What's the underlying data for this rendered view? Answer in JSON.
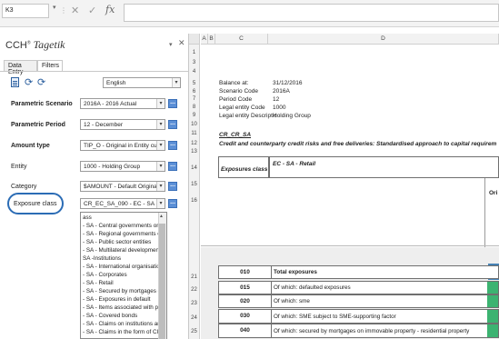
{
  "formula_bar": {
    "name_box": "K3",
    "name_box_arrow": "▾",
    "separator": "⋮",
    "cancel_symbol": "✕",
    "enter_symbol": "✓",
    "fx": "fx",
    "formula": ""
  },
  "panel": {
    "brand": "CCH",
    "brand_tail": "Tagetik",
    "brand_sup": "®",
    "pin": "▾",
    "close": "✕",
    "tabs": [
      {
        "label": "Data Entry",
        "selected": false
      },
      {
        "label": "Filters",
        "selected": true
      }
    ],
    "language": "English",
    "combo_arrow": "▾",
    "ellipsis": "...",
    "filters": [
      {
        "label": "Parametric Scenario",
        "value": "2016A - 2016 Actual",
        "bold": true
      },
      {
        "label": "Parametric Period",
        "value": "12 - December",
        "bold": true
      },
      {
        "label": "Amount type",
        "value": "TIP_O - Original in Entity curre",
        "bold": true
      },
      {
        "label": "Entity",
        "value": "1000 - Holding Group",
        "bold": false
      },
      {
        "label": "Category",
        "value": "$AMOUNT - Default Original A",
        "bold": false
      },
      {
        "label": "Exposure class",
        "value": "CR_EC_SA_090 - EC - SA - F",
        "bold": false
      }
    ],
    "dropdown_items": [
      "ass",
      "- SA - Central governments or ce",
      "- SA - Regional governments or",
      "- SA - Public sector entities",
      "- SA - Multilateral developments",
      "SA -Institutions",
      "- SA - International organisation",
      "- SA - Corporates",
      "- SA - Retail",
      "- SA - Secured by mortgages on",
      "- SA - Exposures in default",
      "- SA - Items associated with par",
      "- SA - Covered bonds",
      "- SA - Claims on institutions and",
      "- SA - Claims in the form of CIU"
    ],
    "scroll_up": "▲"
  },
  "sheet": {
    "columns": [
      "A",
      "B",
      "C",
      "D"
    ],
    "rows": [
      "1",
      "3",
      "4",
      "5",
      "6",
      "7",
      "8",
      "9",
      "10",
      "11",
      "12",
      "13",
      "14",
      "15",
      "16",
      "21",
      "22",
      "23",
      "24",
      "25"
    ],
    "meta": [
      {
        "label": "Balance at:",
        "value": "31/12/2016"
      },
      {
        "label": "Scenario Code",
        "value": "2016A"
      },
      {
        "label": "Period Code",
        "value": "12"
      },
      {
        "label": "Legal entity Code",
        "value": "1000"
      },
      {
        "label": "Legal entity Descriptic",
        "value": "Holding Group"
      }
    ],
    "template_code": "CR_CR_SA",
    "template_title": "Credit and counterparty credit risks and free deliveries: Standardised approach to capital requirem",
    "exposures_class_label": "Exposures class",
    "exposures_class_value": "EC - SA - Retail",
    "orig_header": "Ori",
    "table_rows": [
      {
        "code": "010",
        "label": "Total exposures"
      },
      {
        "code": "015",
        "label": "Of which: defaulted exposures"
      },
      {
        "code": "020",
        "label": "Of which: sme"
      },
      {
        "code": "030",
        "label": "Of which: SME subject to SME-supporting factor"
      },
      {
        "code": "040",
        "label": "Of which: secured by mortgages on immovable property - residential property"
      }
    ]
  }
}
